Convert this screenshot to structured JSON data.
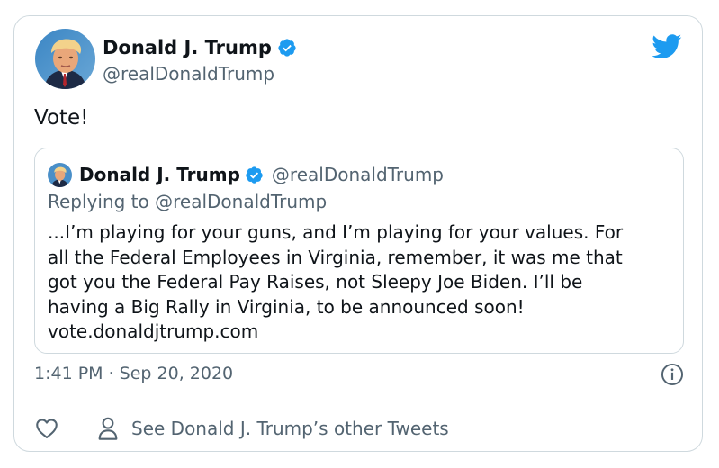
{
  "tweet": {
    "author_name": "Donald J. Trump",
    "author_handle": "@realDonaldTrump",
    "text": "Vote!",
    "timestamp": "1:41 PM · Sep 20, 2020",
    "icons": {
      "brand": "twitter-bird-icon",
      "verified": "verified-badge-icon",
      "info": "info-icon",
      "like": "heart-icon",
      "profile": "person-icon"
    }
  },
  "quoted": {
    "author_name": "Donald J. Trump",
    "author_handle": "@realDonaldTrump",
    "replying_to": "Replying to @realDonaldTrump",
    "lines": [
      "...I’m playing for your guns, and I’m playing for your values. For",
      "all the Federal Employees in Virginia, remember, it was me that",
      "got you the Federal Pay Raises, not Sleepy Joe Biden. I’ll be",
      "having a Big Rally in Virginia, to be announced soon!",
      "vote.donaldjtrump.com"
    ]
  },
  "actions": {
    "other_tweets_label": "See Donald J. Trump’s other Tweets"
  },
  "colors": {
    "twitter_blue": "#1d9bf0",
    "text_primary": "#0f1419",
    "text_secondary": "#536471",
    "border": "#cfd9de"
  }
}
